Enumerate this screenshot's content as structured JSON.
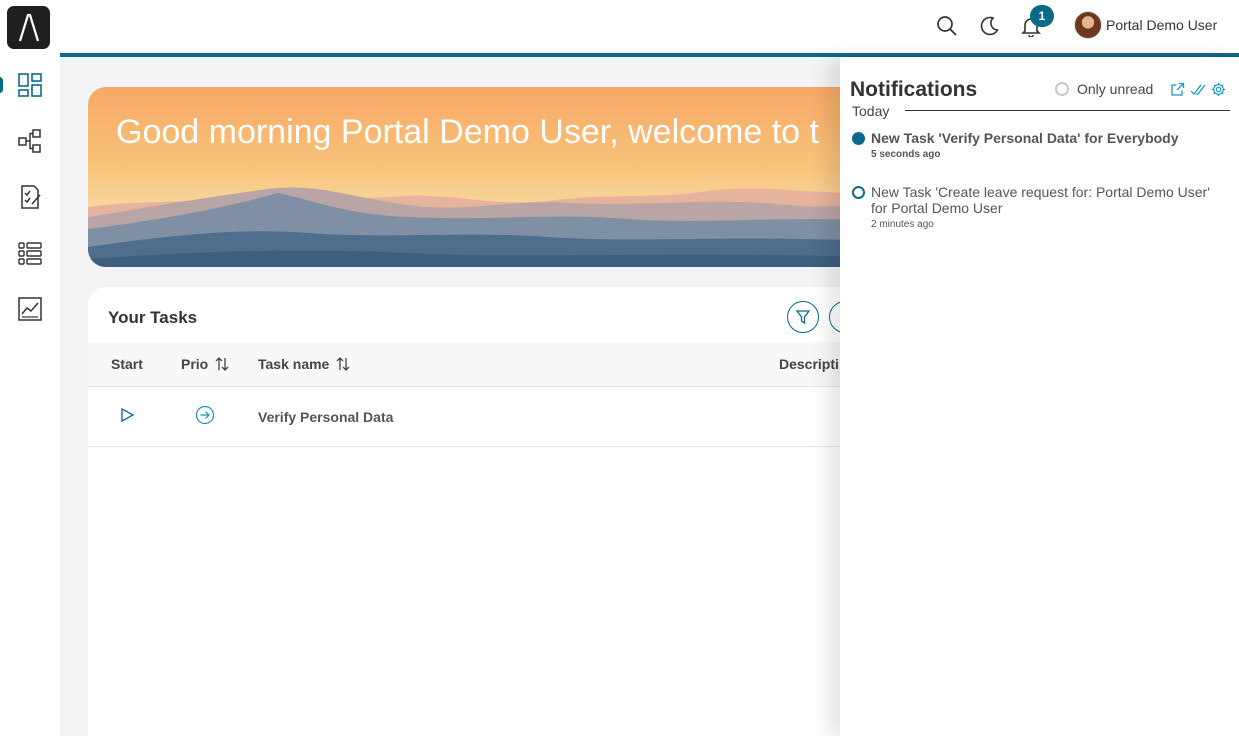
{
  "header": {
    "notification_count": "1",
    "user_name": "Portal Demo User"
  },
  "sidebar": {
    "items": [
      {
        "name": "dashboard-icon"
      },
      {
        "name": "processes-icon"
      },
      {
        "name": "tasks-icon"
      },
      {
        "name": "cases-icon"
      },
      {
        "name": "statistics-icon"
      }
    ]
  },
  "banner": {
    "greeting": "Good morning Portal Demo User, welcome to t"
  },
  "tasks": {
    "title": "Your Tasks",
    "columns": {
      "start": "Start",
      "prio": "Prio",
      "task_name": "Task name",
      "description": "Descripti"
    },
    "rows": [
      {
        "task_name": "Verify Personal Data"
      }
    ]
  },
  "notifications": {
    "title": "Notifications",
    "only_unread_label": "Only unread",
    "group_label": "Today",
    "items": [
      {
        "text": "New Task 'Verify Personal Data' for Everybody",
        "time": "5 seconds ago",
        "unread": true
      },
      {
        "text": "New Task 'Create leave request for: Portal Demo User' for Portal Demo User",
        "time": "2 minutes ago",
        "unread": false
      }
    ]
  },
  "colors": {
    "accent": "#0b6a8a"
  }
}
